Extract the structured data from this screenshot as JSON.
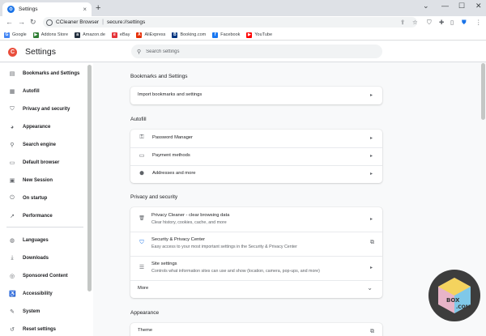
{
  "browser": {
    "tab_title": "Settings",
    "tab_close": "×",
    "new_tab": "+",
    "window_controls": {
      "chevron": "⌄",
      "minimize": "—",
      "maximize": "☐",
      "close": "✕"
    },
    "nav": {
      "back": "←",
      "forward": "→",
      "reload": "↻"
    },
    "omnibox": {
      "brand": "CCleaner Browser",
      "separator": "|",
      "url": "secure://settings"
    },
    "toolbar_icons": [
      "share-icon",
      "star-icon",
      "shield-icon",
      "extensions-icon",
      "sidepanel-icon",
      "security-icon",
      "more-icon"
    ]
  },
  "bookmarks": [
    {
      "label": "Google",
      "icon": "google-icon",
      "color": "#4285f4",
      "glyph": "G"
    },
    {
      "label": "Addons Store",
      "icon": "addons-store-icon",
      "color": "#2e7d32",
      "glyph": "▶"
    },
    {
      "label": "Amazon.de",
      "icon": "amazon-icon",
      "color": "#232f3e",
      "glyph": "a"
    },
    {
      "label": "eBay",
      "icon": "ebay-icon",
      "color": "#e53238",
      "glyph": "e"
    },
    {
      "label": "AliExpress",
      "icon": "aliexpress-icon",
      "color": "#e62e04",
      "glyph": "A"
    },
    {
      "label": "Booking.com",
      "icon": "booking-icon",
      "color": "#003580",
      "glyph": "B"
    },
    {
      "label": "Facebook",
      "icon": "facebook-icon",
      "color": "#1877f2",
      "glyph": "f"
    },
    {
      "label": "YouTube",
      "icon": "youtube-icon",
      "color": "#ff0000",
      "glyph": "▶"
    }
  ],
  "settings": {
    "logo_glyph": "C",
    "title": "Settings",
    "search_placeholder": "Search settings"
  },
  "sidebar": {
    "items": [
      {
        "label": "Bookmarks and Settings",
        "icon": "document-icon",
        "glyph": "▤"
      },
      {
        "label": "Autofill",
        "icon": "autofill-icon",
        "glyph": "▦"
      },
      {
        "label": "Privacy and security",
        "icon": "shield-icon",
        "glyph": "⛉"
      },
      {
        "label": "Appearance",
        "icon": "palette-icon",
        "glyph": "◕"
      },
      {
        "label": "Search engine",
        "icon": "search-icon",
        "glyph": "⚲"
      },
      {
        "label": "Default browser",
        "icon": "browser-icon",
        "glyph": "▭"
      },
      {
        "label": "New Session",
        "icon": "new-session-icon",
        "glyph": "▣"
      },
      {
        "label": "On startup",
        "icon": "power-icon",
        "glyph": "⏻"
      },
      {
        "label": "Performance",
        "icon": "performance-icon",
        "glyph": "↗"
      },
      {
        "label": "Languages",
        "icon": "globe-icon",
        "glyph": "◍"
      },
      {
        "label": "Downloads",
        "icon": "download-icon",
        "glyph": "⤓"
      },
      {
        "label": "Sponsored Content",
        "icon": "sponsored-icon",
        "glyph": "◎"
      },
      {
        "label": "Accessibility",
        "icon": "accessibility-icon",
        "glyph": "♿"
      },
      {
        "label": "System",
        "icon": "wrench-icon",
        "glyph": "🔧"
      },
      {
        "label": "Reset settings",
        "icon": "reset-icon",
        "glyph": "↺"
      }
    ]
  },
  "main": {
    "sections": {
      "bookmarks_title": "Bookmarks and Settings",
      "import_label": "Import bookmarks and settings",
      "autofill_title": "Autofill",
      "password_manager": "Password Manager",
      "payment_methods": "Payment methods",
      "addresses": "Addresses and more",
      "privacy_title": "Privacy and security",
      "privacy_cleaner": "Privacy Cleaner - clear browsing data",
      "privacy_cleaner_sub": "Clear history, cookies, cache, and more",
      "security_center": "Security & Privacy Center",
      "security_center_sub": "Easy access to your most important settings in the Security & Privacy Center",
      "site_settings": "Site settings",
      "site_settings_sub": "Controls what information sites can use and show (location, camera, pop-ups, and more)",
      "more": "More",
      "appearance_title": "Appearance",
      "theme": "Theme"
    },
    "glyphs": {
      "arrow": "▸",
      "external": "⧉",
      "chevron": "⌄",
      "key": "⚿",
      "card": "▭",
      "pin": "⬤",
      "trash": "🗑",
      "shield": "⛉",
      "tune": "☰"
    }
  },
  "watermark": {
    "text_top": "BOX",
    "text_bottom": ".COM"
  }
}
